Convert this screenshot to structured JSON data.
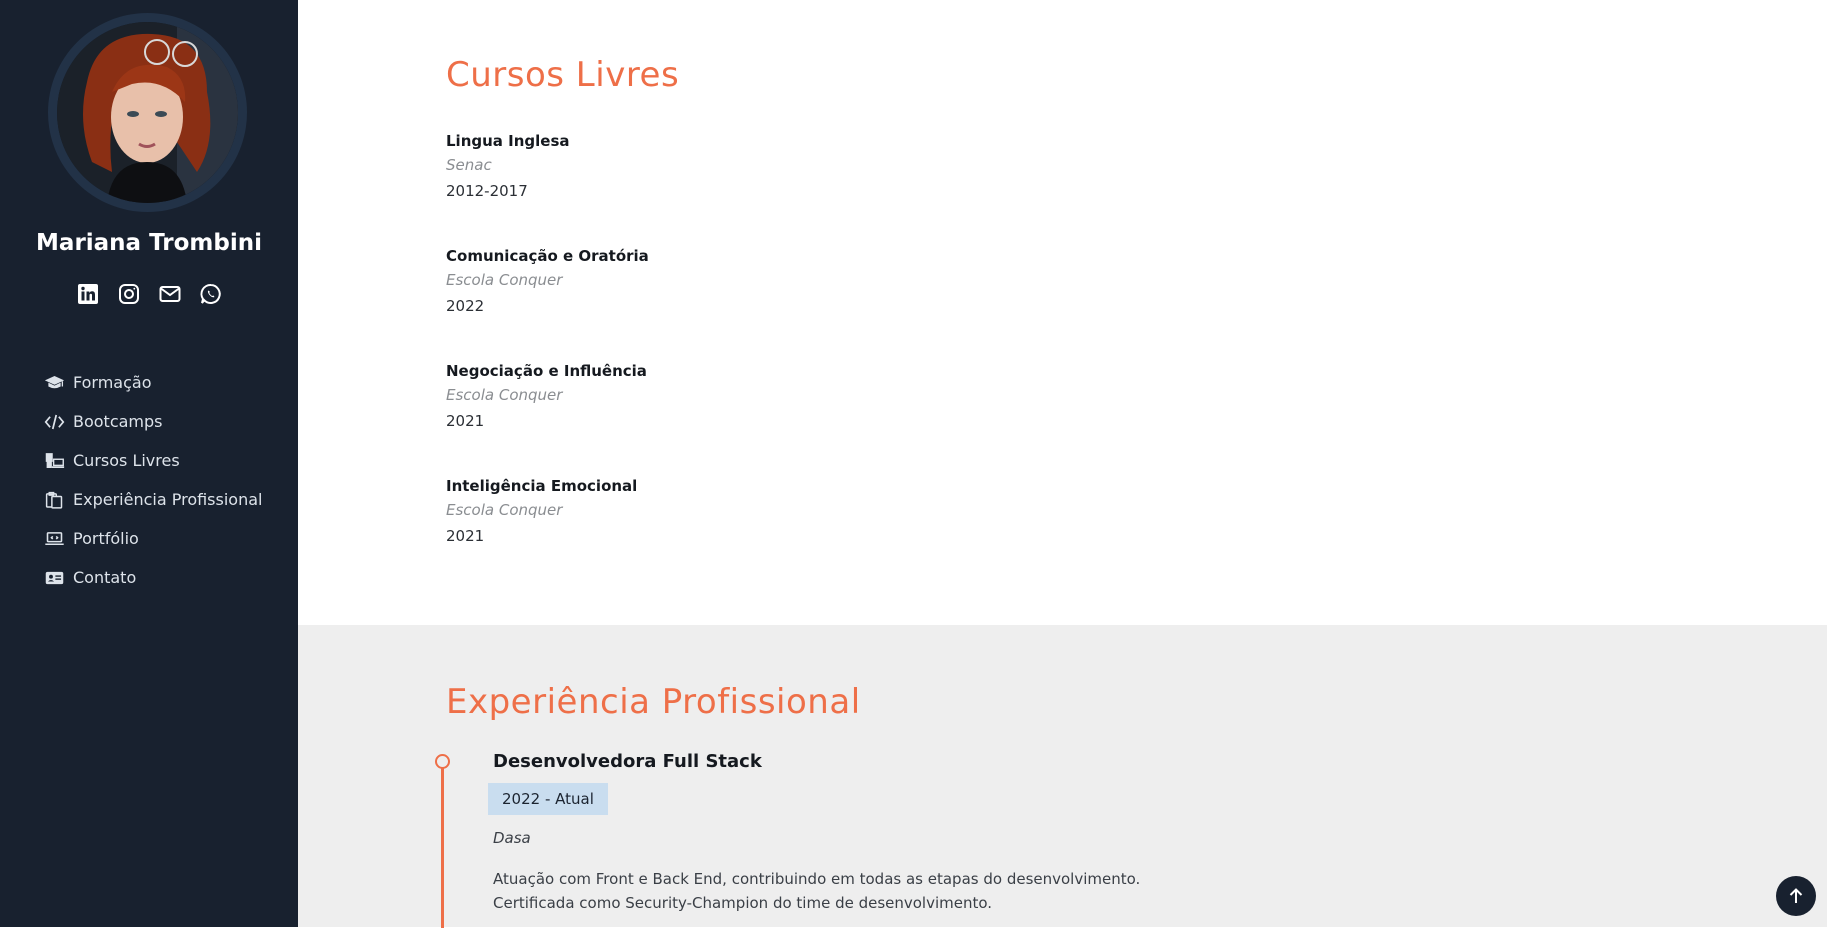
{
  "profile": {
    "name": "Mariana Trombini",
    "avatar_alt": "profile-photo"
  },
  "social": [
    {
      "name": "linkedin-icon"
    },
    {
      "name": "instagram-icon"
    },
    {
      "name": "email-icon"
    },
    {
      "name": "whatsapp-icon"
    }
  ],
  "nav": {
    "items": [
      {
        "label": "Formação",
        "icon": "graduation-cap-icon"
      },
      {
        "label": "Bootcamps",
        "icon": "code-icon"
      },
      {
        "label": "Cursos Livres",
        "icon": "course-icon"
      },
      {
        "label": "Experiência Profissional",
        "icon": "clipboard-icon"
      },
      {
        "label": "Portfólio",
        "icon": "laptop-icon"
      },
      {
        "label": "Contato",
        "icon": "contact-card-icon"
      }
    ]
  },
  "courses_section": {
    "title": "Cursos Livres",
    "items": [
      {
        "name": "Lingua Inglesa",
        "school": "Senac",
        "year": "2012-2017"
      },
      {
        "name": "Comunicação e Oratória",
        "school": "Escola Conquer",
        "year": "2022"
      },
      {
        "name": "Negociação e Influência",
        "school": "Escola Conquer",
        "year": "2021"
      },
      {
        "name": "Inteligência Emocional",
        "school": "Escola Conquer",
        "year": "2021"
      }
    ]
  },
  "experience_section": {
    "title": "Experiência Profissional",
    "jobs": [
      {
        "title": "Desenvolvedora Full Stack",
        "period": "2022 - Atual",
        "company": "Dasa",
        "desc_line1": "Atuação com Front e Back End, contribuindo em todas as etapas do desenvolvimento.",
        "desc_line2": "Certificada como Security-Champion do time de desenvolvimento."
      }
    ]
  },
  "colors": {
    "sidebar_bg": "#18212f",
    "accent": "#ee6f48",
    "section_gray": "#eeeeee",
    "badge_bg": "#c9ddef"
  }
}
